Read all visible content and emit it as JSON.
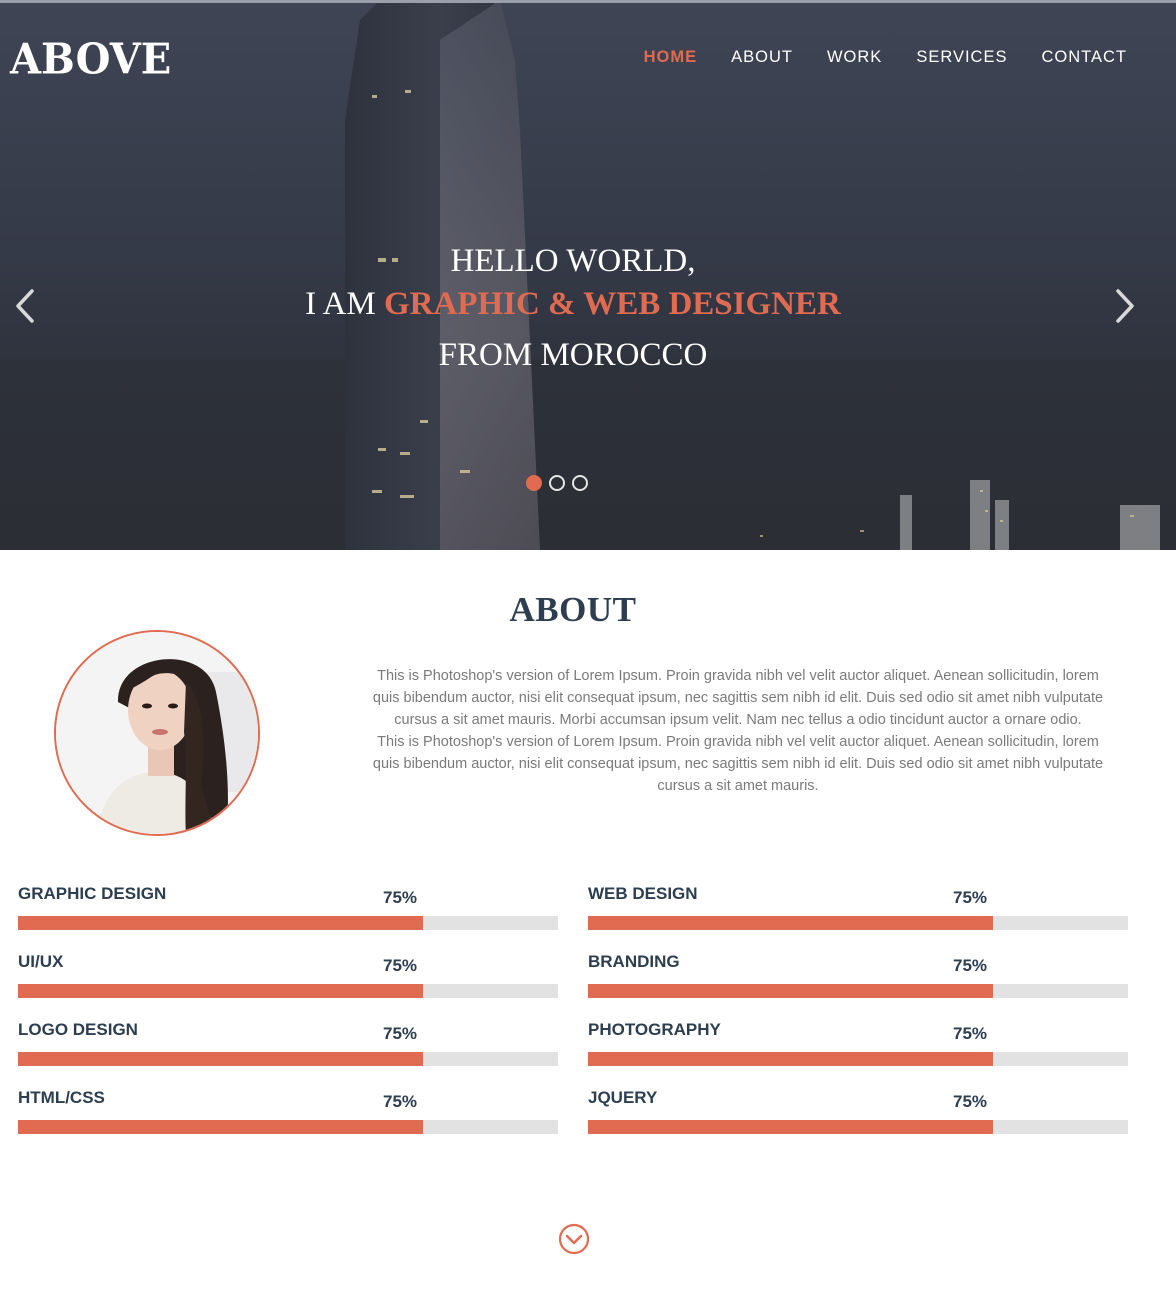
{
  "header": {
    "logo": "ABOVE",
    "nav": [
      {
        "label": "HOME",
        "active": true
      },
      {
        "label": "ABOUT",
        "active": false
      },
      {
        "label": "WORK",
        "active": false
      },
      {
        "label": "SERVICES",
        "active": false
      },
      {
        "label": "CONTACT",
        "active": false
      }
    ]
  },
  "hero": {
    "line1": "HELLO WORLD,",
    "line2_prefix": "I AM ",
    "line2_accent": "GRAPHIC & WEB DESIGNER",
    "line3": "FROM MOROCCO",
    "slides": 3,
    "active_slide": 1
  },
  "about": {
    "title": "ABOUT",
    "paragraph1": "This is Photoshop's version of Lorem Ipsum. Proin gravida nibh vel velit auctor aliquet. Aenean sollicitudin, lorem quis bibendum auctor, nisi elit consequat ipsum, nec sagittis sem nibh id elit. Duis sed odio sit amet nibh vulputate cursus a sit amet mauris. Morbi accumsan ipsum velit. Nam nec tellus a odio tincidunt auctor a ornare odio.",
    "paragraph2": "This is Photoshop's version of Lorem Ipsum. Proin gravida nibh vel velit auctor aliquet. Aenean sollicitudin, lorem quis bibendum auctor, nisi elit consequat ipsum, nec sagittis sem nibh id elit. Duis sed odio sit amet nibh vulputate cursus a sit amet mauris."
  },
  "skills": {
    "left": [
      {
        "name": "GRAPHIC DESIGN",
        "percent_label": "75%",
        "value": 0.75
      },
      {
        "name": "UI/UX",
        "percent_label": "75%",
        "value": 0.75
      },
      {
        "name": "LOGO DESIGN",
        "percent_label": "75%",
        "value": 0.75
      },
      {
        "name": "HTML/CSS",
        "percent_label": "75%",
        "value": 0.75
      }
    ],
    "right": [
      {
        "name": "WEB DESIGN",
        "percent_label": "75%",
        "value": 0.75
      },
      {
        "name": "BRANDING",
        "percent_label": "75%",
        "value": 0.75
      },
      {
        "name": "PHOTOGRAPHY",
        "percent_label": "75%",
        "value": 0.75
      },
      {
        "name": "JQUERY",
        "percent_label": "75%",
        "value": 0.75
      }
    ]
  },
  "colors": {
    "accent": "#e06b50",
    "heading": "#2c3e50",
    "body_text": "#7a7a7a",
    "track": "#e2e2e2"
  },
  "icons": {
    "prev": "chevron-left-icon",
    "next": "chevron-right-icon",
    "scroll": "chevron-circle-down-icon"
  }
}
